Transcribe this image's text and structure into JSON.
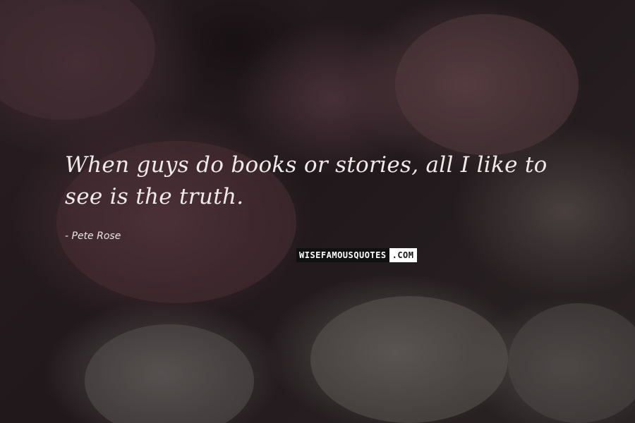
{
  "background": {
    "description_icon": "roses-and-daisies-photo",
    "tint": "#140e10"
  },
  "quote": {
    "text": "When guys do books or stories, all I like to see is the truth."
  },
  "author": {
    "name": "- Pete Rose"
  },
  "logo": {
    "main": "WISEFAMOUSQUOTES",
    "suffix": ".COM"
  }
}
